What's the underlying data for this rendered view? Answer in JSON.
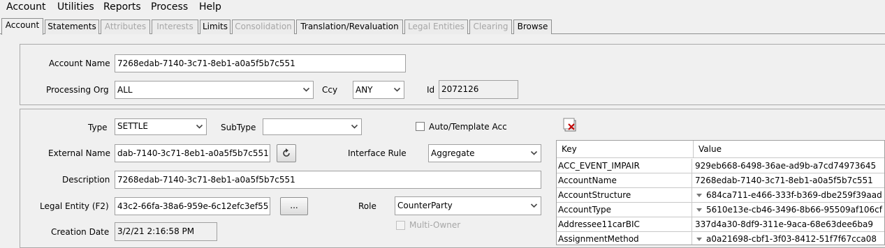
{
  "menu": [
    "Account",
    "Utilities",
    "Reports",
    "Process",
    "Help"
  ],
  "tabs": [
    {
      "label": "Account",
      "state": "active"
    },
    {
      "label": "Statements",
      "state": "enabled"
    },
    {
      "label": "Attributes",
      "state": "disabled"
    },
    {
      "label": "Interests",
      "state": "disabled"
    },
    {
      "label": "Limits",
      "state": "enabled"
    },
    {
      "label": "Consolidation",
      "state": "disabled"
    },
    {
      "label": "Translation/Revaluation",
      "state": "enabled"
    },
    {
      "label": "Legal Entities",
      "state": "disabled"
    },
    {
      "label": "Clearing",
      "state": "disabled"
    },
    {
      "label": "Browse",
      "state": "enabled"
    }
  ],
  "header": {
    "account_name_label": "Account Name",
    "account_name_value": "7268edab-7140-3c71-8eb1-a0a5f5b7c551",
    "processing_org_label": "Processing Org",
    "processing_org_value": "ALL",
    "ccy_label": "Ccy",
    "ccy_value": "ANY",
    "id_label": "Id",
    "id_value": "2072126"
  },
  "details": {
    "type_label": "Type",
    "type_value": "SETTLE",
    "subtype_label": "SubType",
    "subtype_value": "",
    "auto_template_label": "Auto/Template Acc",
    "auto_template_checked": false,
    "external_name_label": "External Name",
    "external_name_value": "dab-7140-3c71-8eb1-a0a5f5b7c551",
    "interface_rule_label": "Interface Rule",
    "interface_rule_value": "Aggregate",
    "description_label": "Description",
    "description_value": "7268edab-7140-3c71-8eb1-a0a5f5b7c551",
    "legal_entity_label": "Legal Entity (F2)",
    "legal_entity_value": "43c2-66fa-38a6-959e-6c12efc3ef55",
    "ellipsis_label": "...",
    "role_label": "Role",
    "role_value": "CounterParty",
    "multi_owner_label": "Multi-Owner",
    "multi_owner_checked": false,
    "creation_date_label": "Creation Date",
    "creation_date_value": "3/2/21 2:16:58 PM"
  },
  "attributes_table": {
    "columns": [
      "Key",
      "Value"
    ],
    "rows": [
      {
        "key": "ACC_EVENT_IMPAIR",
        "value": "929eb668-6498-36ae-ad9b-a7cd74973645",
        "dropdown": false
      },
      {
        "key": "AccountName",
        "value": "7268edab-7140-3c71-8eb1-a0a5f5b7c551",
        "dropdown": false
      },
      {
        "key": "AccountStructure",
        "value": "684ca711-e466-333f-b369-dbe259f39aad",
        "dropdown": true
      },
      {
        "key": "AccountType",
        "value": "5610e13e-cb46-3496-8b66-95509af106cf",
        "dropdown": true
      },
      {
        "key": "Addressee11carBIC",
        "value": "337d4a30-8df9-311e-9aca-68e63dee6ba9",
        "dropdown": false
      },
      {
        "key": "AssignmentMethod",
        "value": "a0a21698-cbf1-3f03-8412-51f7f67cca08",
        "dropdown": true
      }
    ]
  },
  "colors": {
    "background": "#f0f0f0",
    "disabled_text": "#a6a6a6",
    "border": "#a0a0a0"
  }
}
